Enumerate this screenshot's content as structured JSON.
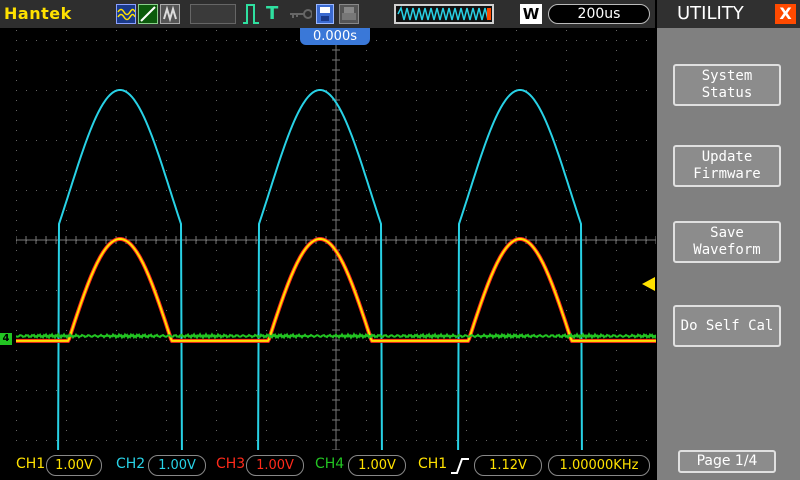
{
  "topbar": {
    "brand": "Hantek",
    "timebase": "200us",
    "wave_mode_letter": "W",
    "trigger_T": "T"
  },
  "trigger_position": "0.000s",
  "ch4_marker": "4",
  "status": {
    "ch1_label": "CH1",
    "ch1_scale": "1.00V",
    "ch2_label": "CH2",
    "ch2_scale": "1.00V",
    "ch3_label": "CH3",
    "ch3_scale": "1.00V",
    "ch4_label": "CH4",
    "ch4_scale": "1.00V",
    "trig_source": "CH1",
    "trig_level": "1.12V",
    "frequency": "1.00000KHz"
  },
  "menu": {
    "title": "UTILITY",
    "close": "X",
    "buttons": [
      {
        "line1": "System",
        "line2": "Status"
      },
      {
        "line1": "Update",
        "line2": "Firmware"
      },
      {
        "line1": "Save",
        "line2": "Waveform"
      },
      {
        "line1": "Do Self Cal",
        "line2": ""
      }
    ],
    "page": "Page 1/4"
  },
  "colors": {
    "ch1": "#ffe100",
    "ch2": "#28d2e6",
    "ch3": "#ff2a1a",
    "ch4": "#22c422",
    "brand": "#ffe100",
    "menu_bg": "#808080"
  },
  "waveforms": {
    "period_divisions": 2,
    "ch2": "clipped inverted sine (cyan)",
    "ch1_ch3": "half-rectified sine (yellow/red overlay)",
    "ch4": "flat line at ground (green)"
  }
}
